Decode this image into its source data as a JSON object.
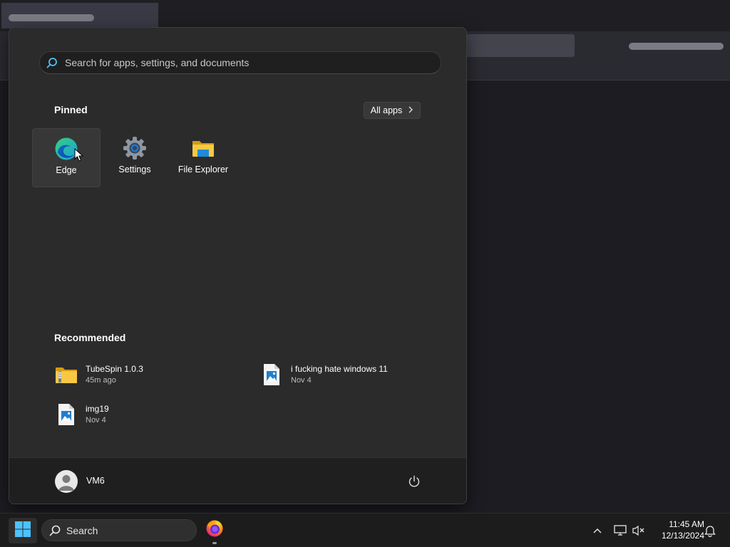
{
  "start_menu": {
    "search_placeholder": "Search for apps, settings, and documents",
    "pinned_title": "Pinned",
    "all_apps_label": "All apps",
    "pinned": [
      {
        "label": "Edge",
        "icon": "edge-icon"
      },
      {
        "label": "Settings",
        "icon": "settings-gear-icon"
      },
      {
        "label": "File Explorer",
        "icon": "folder-icon"
      }
    ],
    "recommended_title": "Recommended",
    "recommended": [
      {
        "name": "TubeSpin 1.0.3",
        "time": "45m ago",
        "icon": "zip-folder-icon"
      },
      {
        "name": "i fucking hate windows 11",
        "time": "Nov 4",
        "icon": "image-file-icon"
      },
      {
        "name": "img19",
        "time": "Nov 4",
        "icon": "image-file-icon"
      }
    ],
    "user": {
      "name": "VM6"
    }
  },
  "taskbar": {
    "search_label": "Search",
    "clock": {
      "time": "11:45 AM",
      "date": "12/13/2024"
    }
  },
  "colors": {
    "accent": "#4cc2ff",
    "menu_bg": "#2b2b2b",
    "taskbar_bg": "#1c1c1c"
  }
}
